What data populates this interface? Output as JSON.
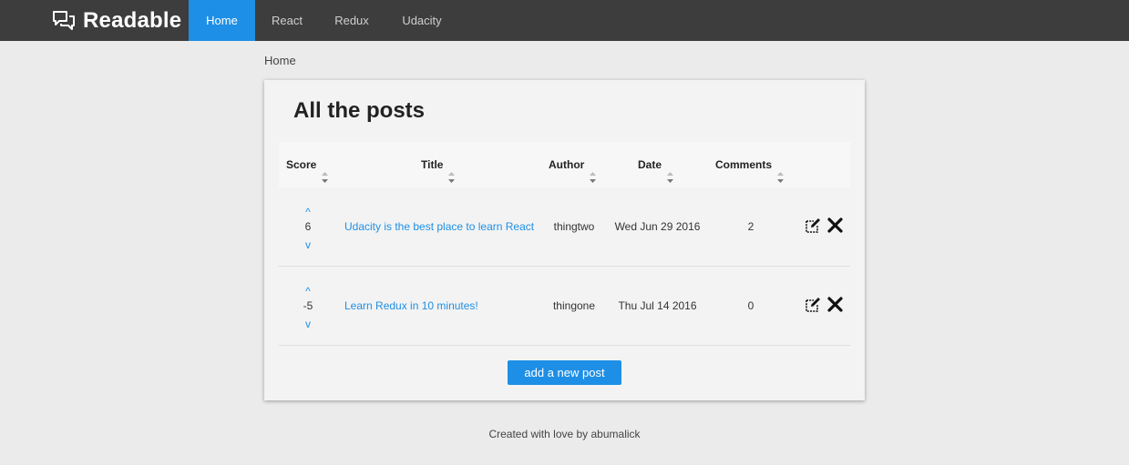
{
  "navbar": {
    "brand": "Readable",
    "brand_icon": "chat-bubbles-icon",
    "items": [
      {
        "label": "Home",
        "active": true
      },
      {
        "label": "React",
        "active": false
      },
      {
        "label": "Redux",
        "active": false
      },
      {
        "label": "Udacity",
        "active": false
      }
    ]
  },
  "breadcrumb": "Home",
  "main": {
    "title": "All the posts",
    "columns": [
      {
        "label": "Score"
      },
      {
        "label": "Title"
      },
      {
        "label": "Author"
      },
      {
        "label": "Date"
      },
      {
        "label": "Comments"
      }
    ],
    "posts": [
      {
        "score": "6",
        "title": "Udacity is the best place to learn React",
        "author": "thingtwo",
        "date": "Wed Jun 29 2016",
        "comments": "2"
      },
      {
        "score": "-5",
        "title": "Learn Redux in 10 minutes!",
        "author": "thingone",
        "date": "Thu Jul 14 2016",
        "comments": "0"
      }
    ],
    "vote_up_symbol": "^",
    "vote_down_symbol": "v",
    "add_button_label": "add a new post"
  },
  "footer": "Created with love by abumalick",
  "colors": {
    "navbar_bg": "#3d3d3d",
    "accent": "#1e8fe6",
    "page_bg": "#ebebeb",
    "card_bg": "#f3f3f3"
  }
}
